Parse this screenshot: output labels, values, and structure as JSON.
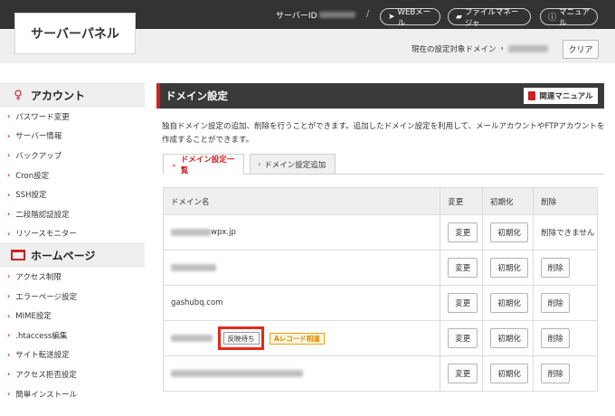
{
  "header": {
    "logo": "サーバーパネル",
    "server_id_label": "サーバーID",
    "separator": "/",
    "webmail_label": "WEBメール",
    "filemanager_label": "ファイルマネージャ",
    "manual_label": "マニュアル",
    "target_domain_label": "現在の設定対象ドメイン",
    "target_arrow": "›",
    "clear_label": "クリア"
  },
  "sidebar": {
    "sections": [
      {
        "title": "アカウント",
        "icon": "person-icon",
        "items": [
          "パスワード変更",
          "サーバー情報",
          "バックアップ",
          "Cron設定",
          "SSH設定",
          "二段階認証設定",
          "リソースモニター"
        ]
      },
      {
        "title": "ホームページ",
        "icon": "screen-icon",
        "items": [
          "アクセス制限",
          "エラーページ設定",
          "MIME設定",
          ".htaccess編集",
          "サイト転送設定",
          "アクセス拒否設定",
          "簡単インストール"
        ]
      }
    ]
  },
  "main": {
    "title": "ドメイン設定",
    "manual_button": "関連マニュアル",
    "description": "独自ドメイン設定の追加、削除を行うことができます。追加したドメイン設定を利用して、メールアカウントやFTPアカウントを作成することができます。",
    "tabs": [
      {
        "label": "ドメイン設定一覧",
        "active": true
      },
      {
        "label": "ドメイン設定追加",
        "active": false
      }
    ],
    "table": {
      "headers": [
        "ドメイン名",
        "変更",
        "初期化",
        "削除"
      ],
      "rows": [
        {
          "domain_suffix": "wpx.jp",
          "change": "変更",
          "init": "初期化",
          "delete": "削除できません"
        },
        {
          "domain_suffix": "",
          "change": "変更",
          "init": "初期化",
          "delete": "削除"
        },
        {
          "domain_suffix": "gashubq.com",
          "change": "変更",
          "init": "初期化",
          "delete": "削除"
        },
        {
          "domain_suffix": "",
          "status": "反映待ち",
          "badge": "Aレコード相違",
          "change": "変更",
          "init": "初期化",
          "delete": "削除"
        },
        {
          "domain_suffix": "",
          "change": "変更",
          "init": "初期化",
          "delete": "削除"
        }
      ]
    }
  },
  "colors": {
    "accent": "#cc2222",
    "header_dark": "#333333",
    "highlight_box": "#e5281c",
    "badge": "#e8a11a"
  }
}
